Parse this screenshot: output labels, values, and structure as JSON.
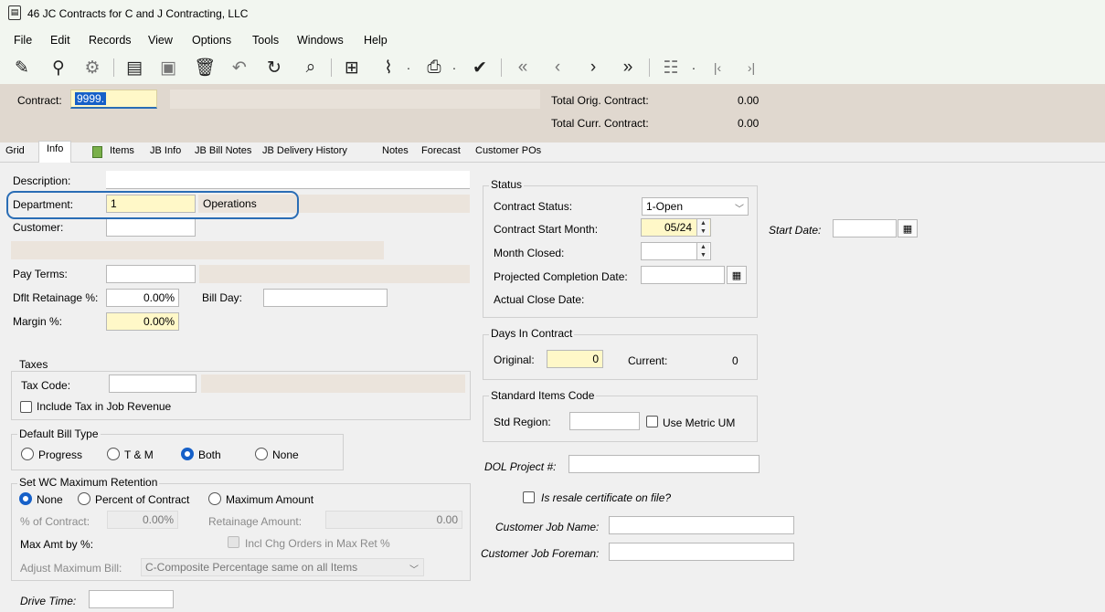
{
  "window": {
    "title": "46 JC Contracts for C and J Contracting, LLC"
  },
  "menu": [
    "File",
    "Edit",
    "Records",
    "View",
    "Options",
    "Tools",
    "Windows",
    "Help"
  ],
  "header": {
    "contract_label": "Contract:",
    "contract_value": "9999.",
    "total_orig_label": "Total Orig. Contract:",
    "total_orig_value": "0.00",
    "total_curr_label": "Total Curr. Contract:",
    "total_curr_value": "0.00"
  },
  "tabs": [
    "Grid",
    "Info",
    "Items",
    "JB Info",
    "JB Bill Notes",
    "JB Delivery History",
    "Notes",
    "Forecast",
    "Customer POs"
  ],
  "info": {
    "description_label": "Description:",
    "department_label": "Department:",
    "department_value": "1",
    "department_desc": "Operations",
    "customer_label": "Customer:",
    "pay_terms_label": "Pay Terms:",
    "dflt_retainage_label": "Dflt Retainage %:",
    "dflt_retainage_value": "0.00%",
    "bill_day_label": "Bill Day:",
    "margin_label": "Margin %:",
    "margin_value": "0.00%",
    "taxes_title": "Taxes",
    "tax_code_label": "Tax Code:",
    "include_tax_label": "Include Tax in Job Revenue",
    "default_bill_type_title": "Default Bill Type",
    "bill_types": [
      "Progress",
      "T & M",
      "Both",
      "None"
    ],
    "bill_type_selected": "Both",
    "wc_title": "Set WC Maximum Retention",
    "wc_options": [
      "None",
      "Percent of Contract",
      "Maximum Amount"
    ],
    "wc_selected": "None",
    "pct_contract_label": "% of Contract:",
    "pct_contract_value": "0.00%",
    "retainage_amount_label": "Retainage Amount:",
    "retainage_amount_value": "0.00",
    "max_amt_label": "Max Amt by %:",
    "incl_chg_label": "Incl Chg Orders in Max Ret %",
    "adjust_max_label": "Adjust Maximum Bill:",
    "adjust_max_value": "C-Composite Percentage same on all Items",
    "drive_time_label": "Drive Time:"
  },
  "status": {
    "title": "Status",
    "contract_status_label": "Contract Status:",
    "contract_status_value": "1-Open",
    "start_month_label": "Contract Start Month:",
    "start_month_value": "05/24",
    "month_closed_label": "Month Closed:",
    "projected_completion_label": "Projected Completion Date:",
    "actual_close_label": "Actual Close Date:",
    "start_date_label": "Start Date:"
  },
  "days": {
    "title": "Days In Contract",
    "original_label": "Original:",
    "original_value": "0",
    "current_label": "Current:",
    "current_value": "0"
  },
  "std_items": {
    "title": "Standard Items Code",
    "std_region_label": "Std Region:",
    "metric_label": "Use Metric UM"
  },
  "extra": {
    "dol_label": "DOL Project #:",
    "resale_label": "Is resale certificate on file?",
    "job_name_label": "Customer Job Name:",
    "job_foreman_label": "Customer Job Foreman:"
  }
}
